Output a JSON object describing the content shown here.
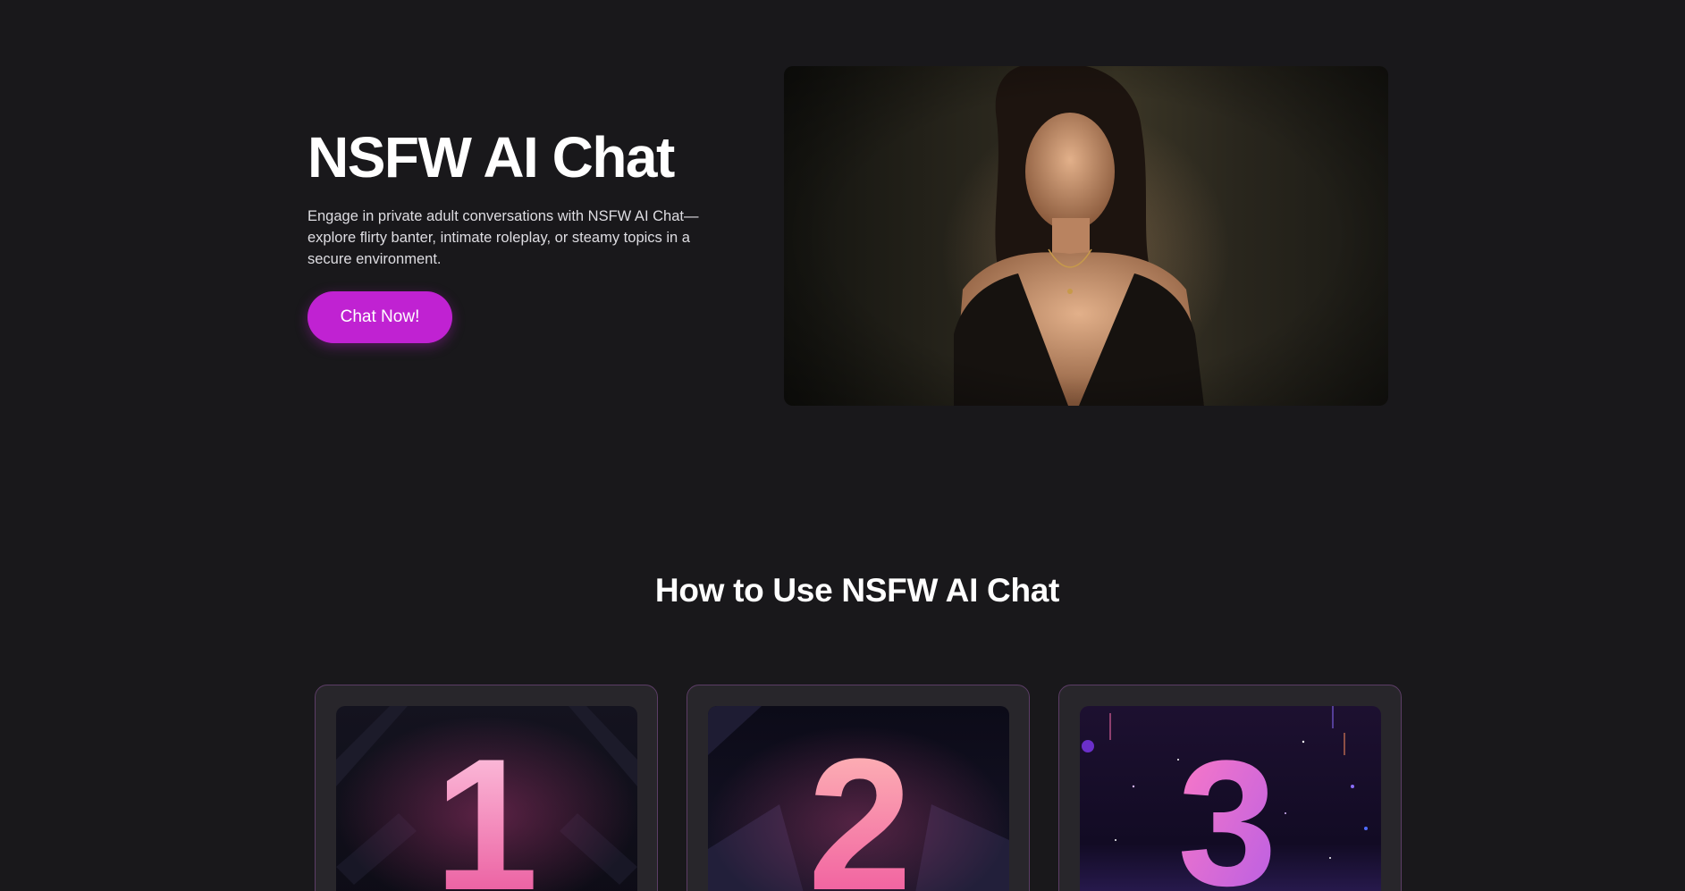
{
  "hero": {
    "title": "NSFW AI Chat",
    "description": "Engage in private adult conversations with NSFW AI Chat—explore flirty banter, intimate roleplay, or steamy topics in a secure environment.",
    "cta_label": "Chat Now!"
  },
  "how_to": {
    "title": "How to Use NSFW AI Chat",
    "steps": [
      {
        "number": "1"
      },
      {
        "number": "2"
      },
      {
        "number": "3"
      }
    ]
  },
  "colors": {
    "background": "#19181b",
    "accent": "#c022d2",
    "card_background": "#28262b",
    "card_border": "#5c3d66",
    "number_pink": "#f25fa8"
  }
}
